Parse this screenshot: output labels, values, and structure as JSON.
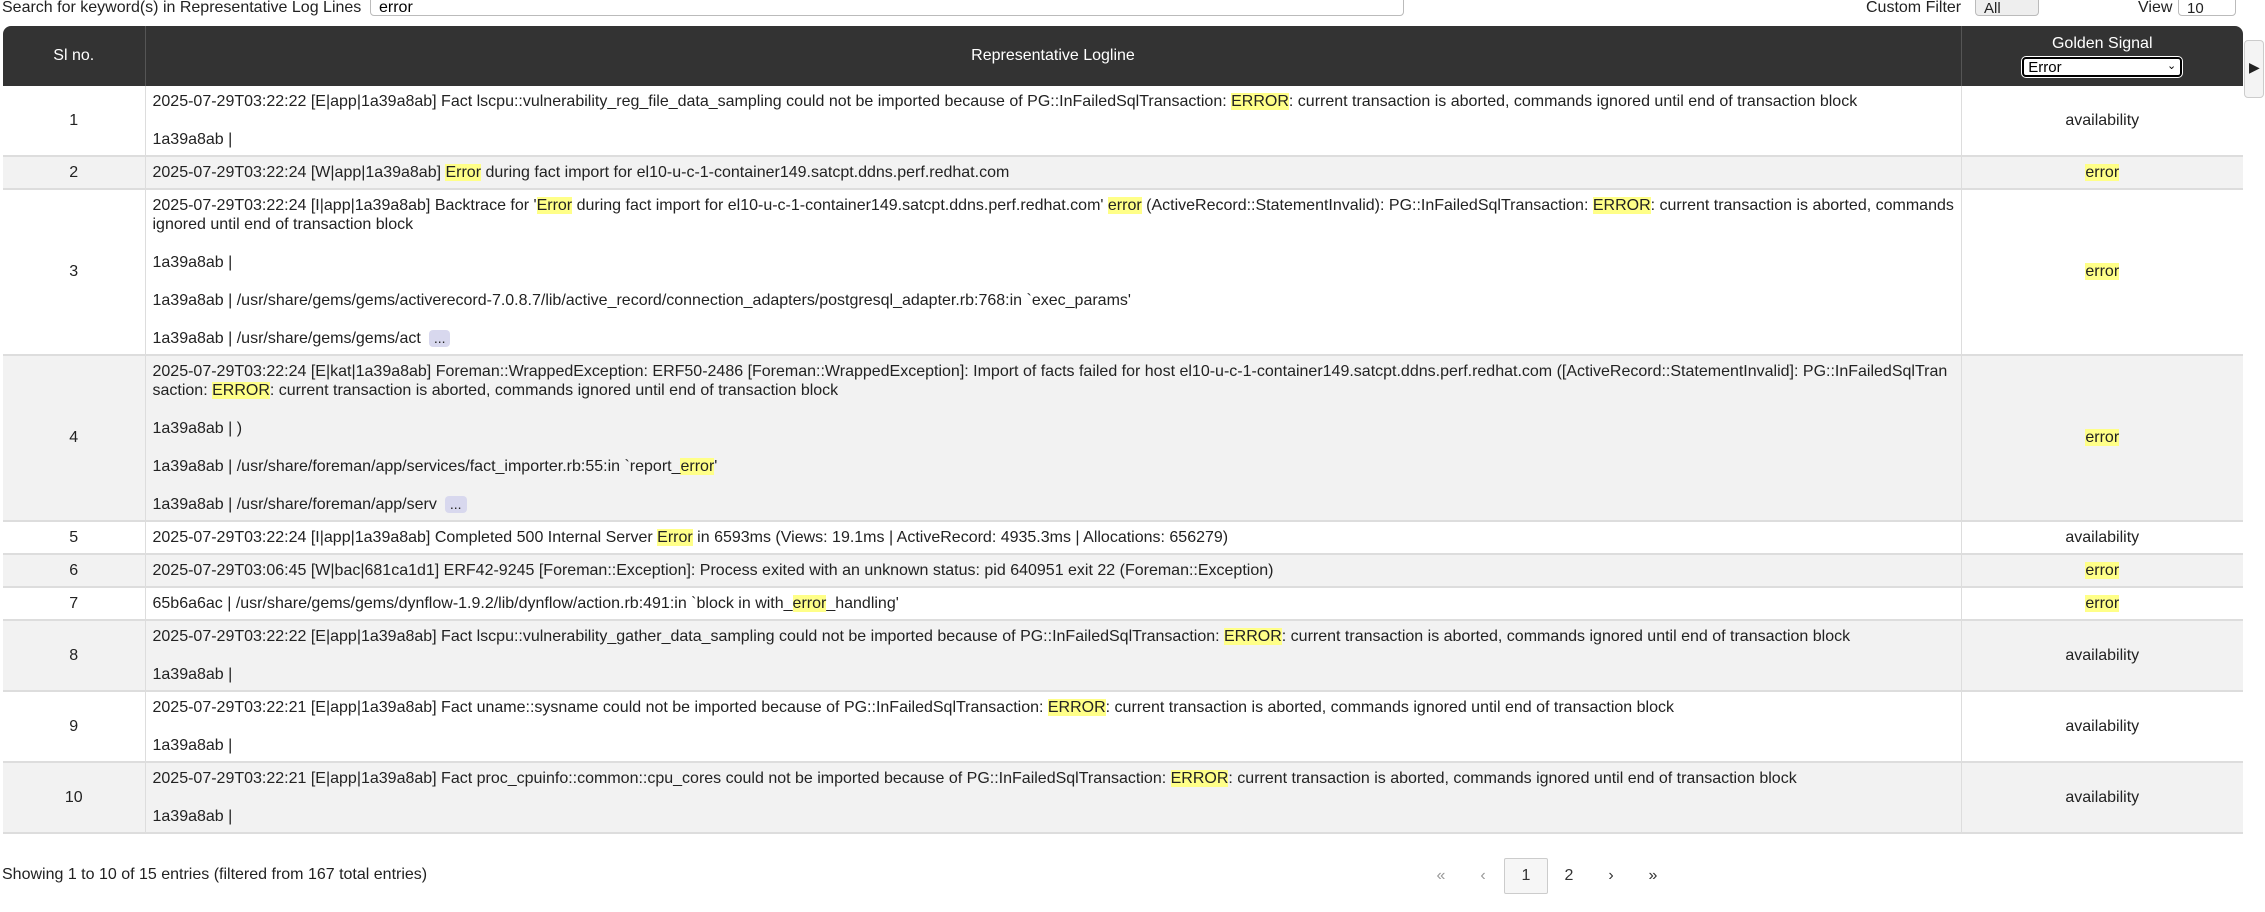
{
  "search": {
    "label": "Search for keyword(s) in Representative Log Lines",
    "value": "error"
  },
  "custom_filter": {
    "label": "Custom Filter",
    "value": "All"
  },
  "view": {
    "label": "View",
    "value": "10"
  },
  "table": {
    "headers": {
      "sl": "Sl no.",
      "log": "Representative Logline",
      "gs": "Golden Signal"
    },
    "golden_signal_filter": "Error",
    "highlight_term": "error",
    "highlight_color": "#ffff88",
    "more_label": "...",
    "rows": [
      {
        "sl": "1",
        "lines": [
          "2025-07-29T03:22:22 [E|app|1a39a8ab] Fact lscpu::vulnerability_reg_file_data_sampling could not be imported because of PG::InFailedSqlTransaction: ERROR: current transaction is aborted, commands ignored until end of transaction block",
          "1a39a8ab |"
        ],
        "truncated": false,
        "signal": "availability"
      },
      {
        "sl": "2",
        "lines": [
          "2025-07-29T03:22:24 [W|app|1a39a8ab] Error during fact import for el10-u-c-1-container149.satcpt.ddns.perf.redhat.com"
        ],
        "truncated": false,
        "signal": "error"
      },
      {
        "sl": "3",
        "lines": [
          "2025-07-29T03:22:24 [I|app|1a39a8ab] Backtrace for 'Error during fact import for el10-u-c-1-container149.satcpt.ddns.perf.redhat.com' error (ActiveRecord::StatementInvalid): PG::InFailedSqlTransaction: ERROR: current transaction is aborted, commands ignored until end of transaction block",
          "1a39a8ab |",
          "1a39a8ab | /usr/share/gems/gems/activerecord-7.0.8.7/lib/active_record/connection_adapters/postgresql_adapter.rb:768:in `exec_params'",
          "1a39a8ab | /usr/share/gems/gems/act"
        ],
        "truncated": true,
        "signal": "error"
      },
      {
        "sl": "4",
        "lines": [
          "2025-07-29T03:22:24 [E|kat|1a39a8ab] Foreman::WrappedException: ERF50-2486 [Foreman::WrappedException]: Import of facts failed for host el10-u-c-1-container149.satcpt.ddns.perf.redhat.com ([ActiveRecord::StatementInvalid]: PG::InFailedSqlTransaction: ERROR: current transaction is aborted, commands ignored until end of transaction block",
          "1a39a8ab | )",
          "1a39a8ab | /usr/share/foreman/app/services/fact_importer.rb:55:in `report_error'",
          "1a39a8ab | /usr/share/foreman/app/serv"
        ],
        "truncated": true,
        "signal": "error"
      },
      {
        "sl": "5",
        "lines": [
          "2025-07-29T03:22:24 [I|app|1a39a8ab] Completed 500 Internal Server Error in 6593ms (Views: 19.1ms | ActiveRecord: 4935.3ms | Allocations: 656279)"
        ],
        "truncated": false,
        "signal": "availability"
      },
      {
        "sl": "6",
        "lines": [
          "2025-07-29T03:06:45 [W|bac|681ca1d1] ERF42-9245 [Foreman::Exception]: Process exited with an unknown status: pid 640951 exit 22 (Foreman::Exception)"
        ],
        "truncated": false,
        "signal": "error"
      },
      {
        "sl": "7",
        "lines": [
          "65b6a6ac | /usr/share/gems/gems/dynflow-1.9.2/lib/dynflow/action.rb:491:in `block in with_error_handling'"
        ],
        "truncated": false,
        "signal": "error"
      },
      {
        "sl": "8",
        "lines": [
          "2025-07-29T03:22:22 [E|app|1a39a8ab] Fact lscpu::vulnerability_gather_data_sampling could not be imported because of PG::InFailedSqlTransaction: ERROR: current transaction is aborted, commands ignored until end of transaction block",
          "1a39a8ab |"
        ],
        "truncated": false,
        "signal": "availability"
      },
      {
        "sl": "9",
        "lines": [
          "2025-07-29T03:22:21 [E|app|1a39a8ab] Fact uname::sysname could not be imported because of PG::InFailedSqlTransaction: ERROR: current transaction is aborted, commands ignored until end of transaction block",
          "1a39a8ab |"
        ],
        "truncated": false,
        "signal": "availability"
      },
      {
        "sl": "10",
        "lines": [
          "2025-07-29T03:22:21 [E|app|1a39a8ab] Fact proc_cpuinfo::common::cpu_cores could not be imported because of PG::InFailedSqlTransaction: ERROR: current transaction is aborted, commands ignored until end of transaction block",
          "1a39a8ab |"
        ],
        "truncated": false,
        "signal": "availability"
      }
    ]
  },
  "footer": {
    "info": "Showing 1 to 10 of 15 entries (filtered from 167 total entries)",
    "pagination": {
      "first": "«",
      "prev": "‹",
      "pages": [
        "1",
        "2"
      ],
      "current": "1",
      "next": "›",
      "last": "»"
    }
  },
  "icons": {
    "panel_toggle": "caret-right-icon",
    "select_chevron": "chevron-down-icon"
  }
}
